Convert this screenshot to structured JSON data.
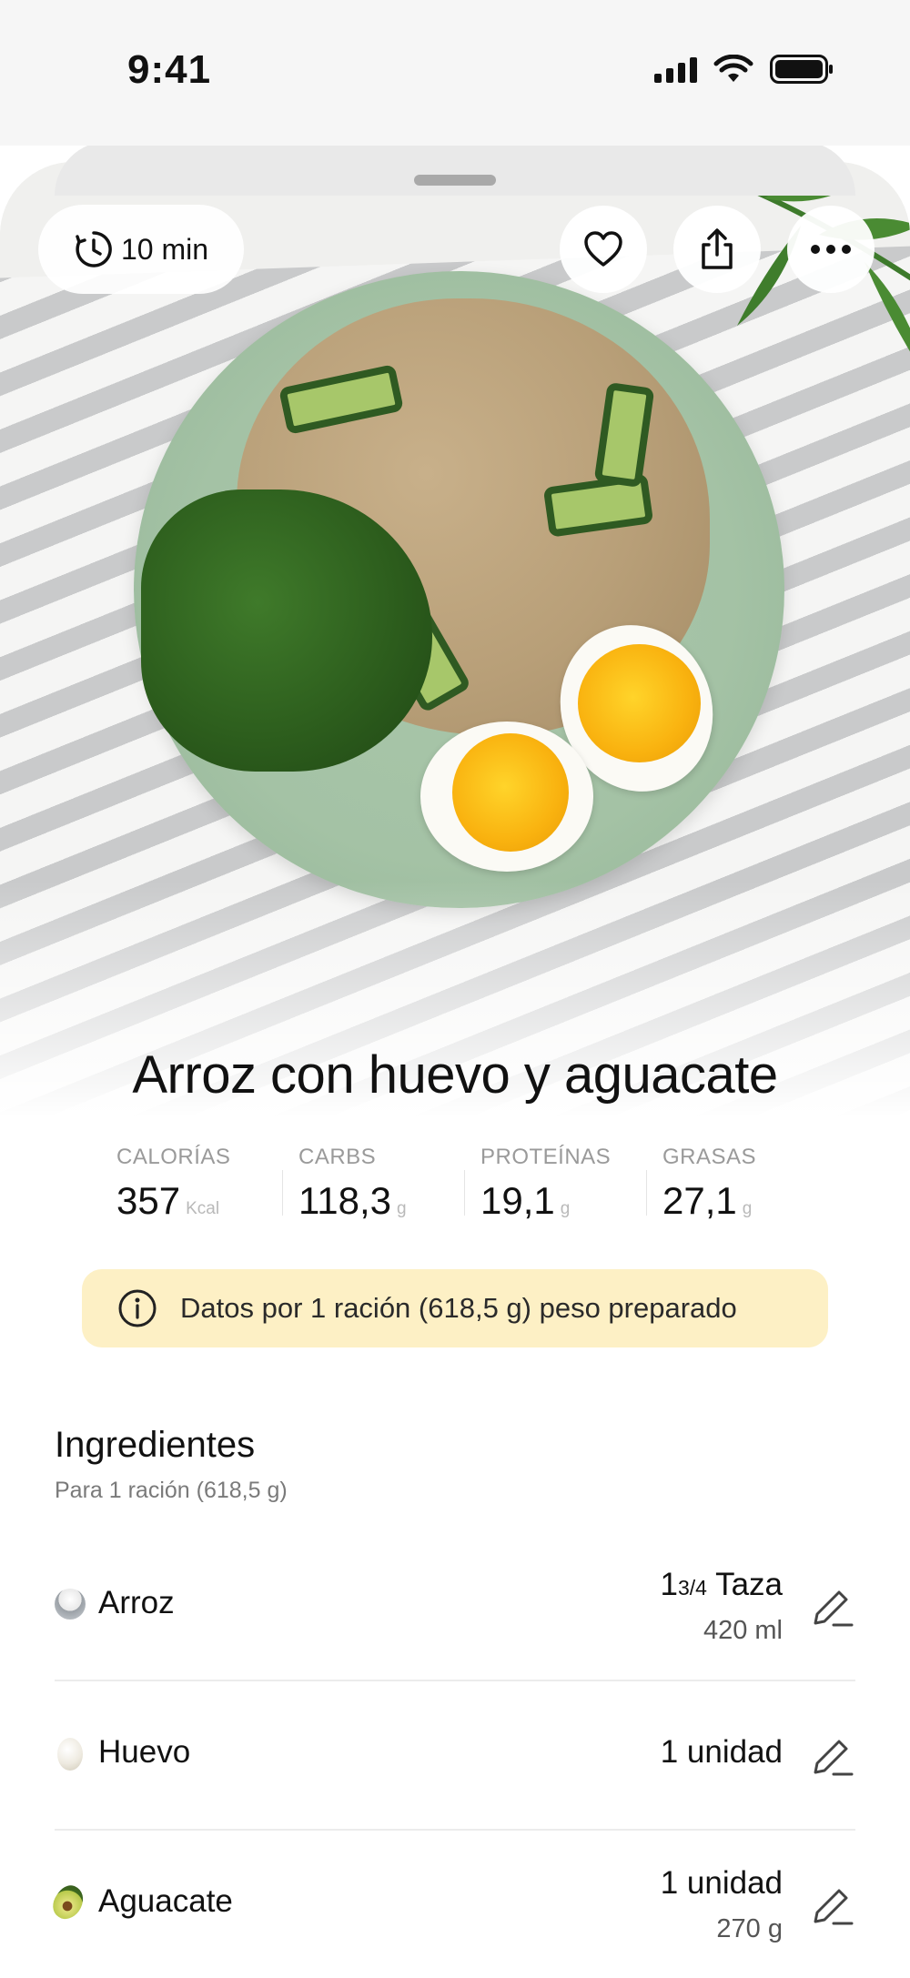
{
  "status_bar": {
    "time": "9:41"
  },
  "recipe": {
    "prep_time": "10 min",
    "title": "Arroz con huevo y aguacate"
  },
  "nutrition": [
    {
      "label": "CALORÍAS",
      "value": "357",
      "unit": "Kcal"
    },
    {
      "label": "CARBS",
      "value": "118,3",
      "unit": "g"
    },
    {
      "label": "PROTEÍNAS",
      "value": "19,1",
      "unit": "g"
    },
    {
      "label": "GRASAS",
      "value": "27,1",
      "unit": "g"
    }
  ],
  "info_banner": {
    "text": "Datos por 1 ración (618,5 g) peso preparado"
  },
  "ingredients": {
    "title": "Ingredientes",
    "subtitle": "Para 1 ración (618,5 g)",
    "items": [
      {
        "name": "Arroz",
        "qty_whole": "1",
        "qty_fraction": "3/4",
        "qty_unit": "Taza",
        "alt": "420 ml",
        "icon": "rice-bowl-icon"
      },
      {
        "name": "Huevo",
        "qty": "1 unidad",
        "alt": "",
        "icon": "egg-icon"
      },
      {
        "name": "Aguacate",
        "qty": "1 unidad",
        "alt": "270 g",
        "icon": "avocado-icon"
      }
    ]
  },
  "icons": {
    "time": "clock-icon",
    "favorite": "heart-icon",
    "share": "share-icon",
    "more": "more-horizontal-icon",
    "info": "info-icon",
    "edit": "pencil-icon"
  },
  "colors": {
    "info_banner_bg": "#fdf0c5",
    "plate": "#a4c2a5",
    "text": "#111111",
    "muted": "#9a9a9a"
  }
}
